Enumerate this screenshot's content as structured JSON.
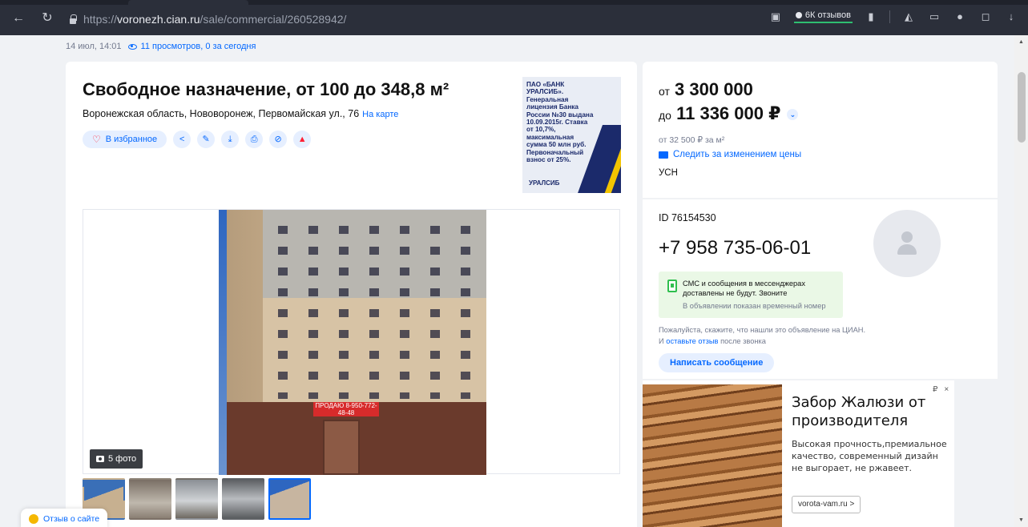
{
  "browser": {
    "url_prefix": "https://",
    "url_host": "voronezh.cian.ru",
    "url_path": "/sale/commercial/260528942/",
    "reviews_badge": "6К отзывов"
  },
  "meta": {
    "date": "14 июл, 14:01",
    "views": "11 просмотров, 0 за сегодня"
  },
  "listing": {
    "title": "Свободное назначение, от 100 до 348,8 м²",
    "address": "Воронежская область, Нововоронеж, Первомайская ул., 76",
    "map_link": "На карте",
    "favorite_label": "В избранное",
    "photo_count": "5 фото",
    "photo_sign": "ПРОДАЮ 8-950-772-48-48"
  },
  "bank_ad": {
    "text": "ПАО «БАНК УРАЛСИБ». Генеральная лицензия Банка России №30 выдана 10.09.2015г. Ставка от 10,7%, максимальная сумма 50 млн руб. Первоначальный взнос от 25%.",
    "logo": "УРАЛСИБ"
  },
  "price": {
    "from_prefix": "от",
    "from_value": "3 300 000",
    "to_prefix": "до",
    "to_value": "11 336 000 ₽",
    "per_meter": "от 32 500 ₽ за м²",
    "follow_label": "Следить за изменением цены",
    "tax": "УСН"
  },
  "contact": {
    "id": "ID 76154530",
    "phone": "+7 958 735-06-01",
    "sms_text": "СМС и сообщения в мессенджерах доставлены не будут. Звоните",
    "sms_note": "В объявлении показан временный номер",
    "please_text": "Пожалуйста, скажите, что нашли это объявление на ЦИАН. И",
    "please_link": "оставьте отзыв",
    "please_tail": "после звонка",
    "message_button": "Написать сообщение"
  },
  "promo": {
    "title": "Забор Жалюзи от производителя",
    "description": "Высокая прочность,премиальное качество, современный дизайн не выгорает, не ржавеет.",
    "site": "vorota-vam.ru >",
    "currency_mark": "₽",
    "close_mark": "×"
  },
  "feedback_label": "Отзыв о сайте",
  "icons": [
    "back-icon",
    "reload-icon",
    "lock-icon",
    "share-icon",
    "edit-icon",
    "download-icon",
    "print-icon",
    "hide-icon",
    "complaint-icon",
    "camera-icon",
    "mail-icon",
    "phone-icon",
    "avatar-icon"
  ]
}
